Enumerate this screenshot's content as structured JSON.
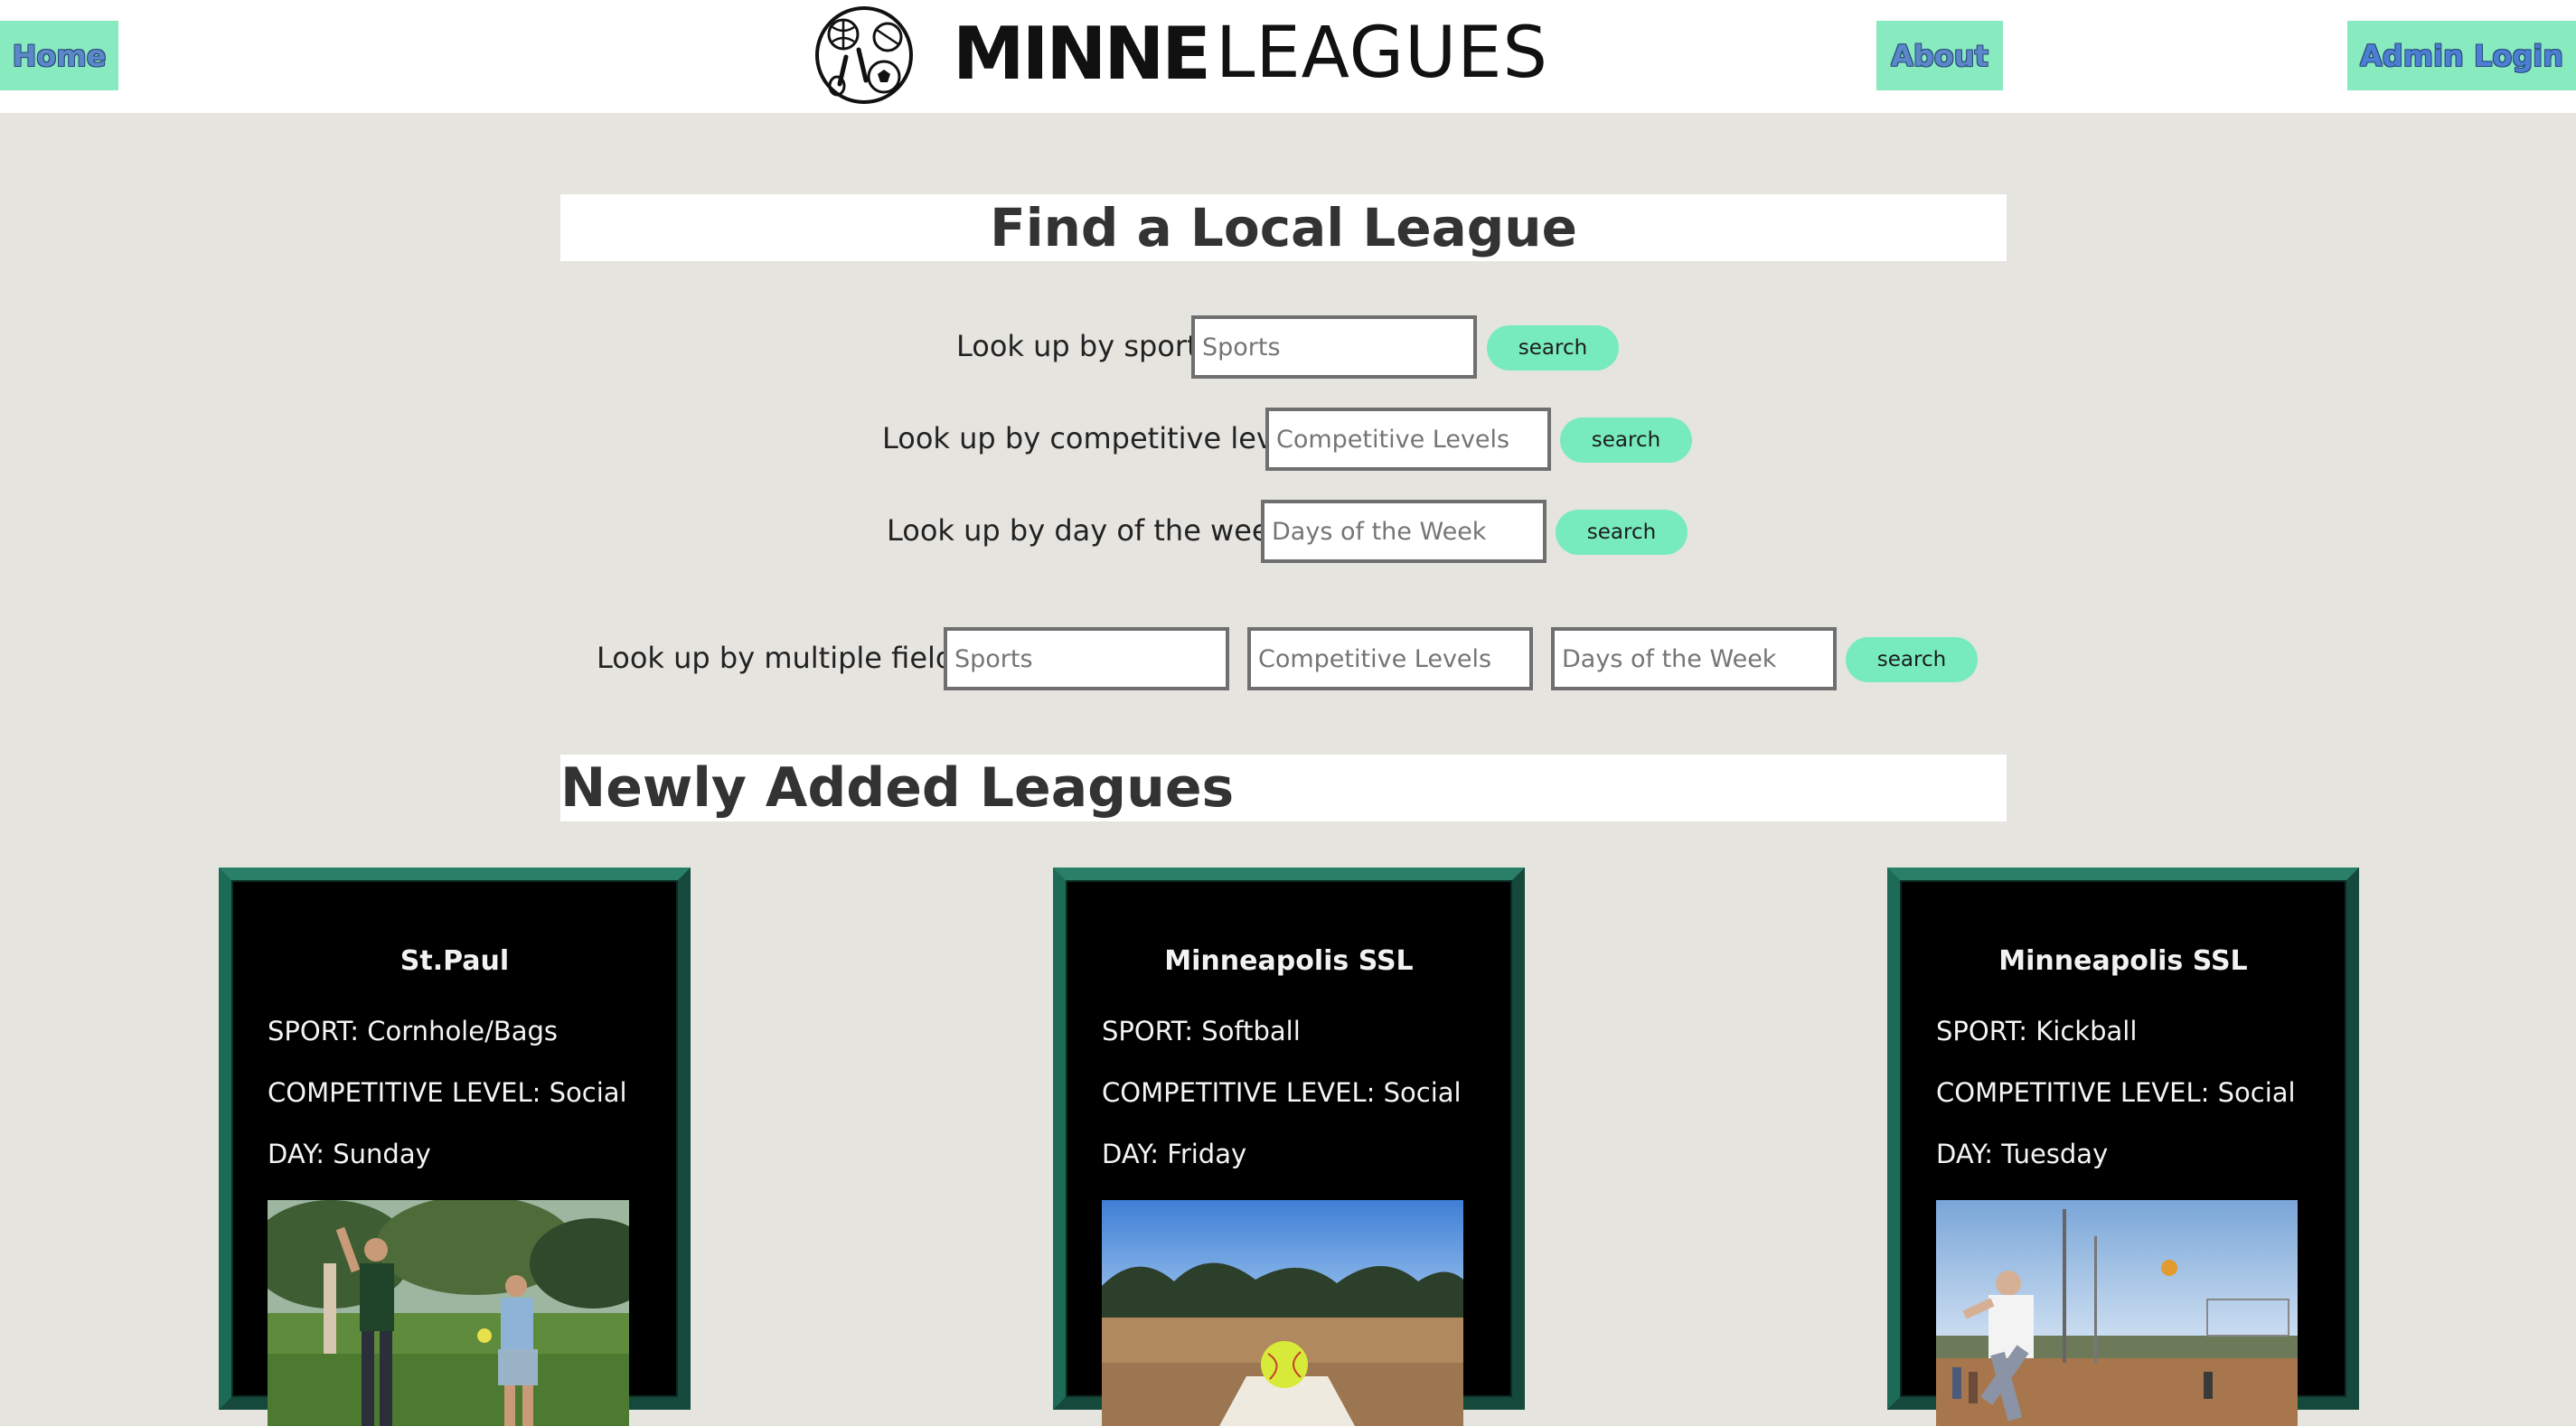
{
  "nav": {
    "home": "Home",
    "about": "About",
    "admin": "Admin Login"
  },
  "logo": {
    "bold": "MINNE",
    "light": "LEAGUES",
    "icon": "sports-balls-icon"
  },
  "find": {
    "title": "Find a Local League",
    "rows": [
      {
        "label": "Look up by sport:",
        "placeholder": "Sports",
        "button": "search"
      },
      {
        "label": "Look up by competitive level:",
        "placeholder": "Competitive Levels",
        "button": "search"
      },
      {
        "label": "Look up by day of the week:",
        "placeholder": "Days of the Week",
        "button": "search"
      }
    ],
    "multi": {
      "label": "Look up by multiple fields:",
      "placeholders": [
        "Sports",
        "Competitive Levels",
        "Days of the Week"
      ],
      "button": "search"
    }
  },
  "newly": {
    "title": "Newly Added Leagues",
    "cards": [
      {
        "name": "St.Paul",
        "sport": "SPORT: Cornhole/Bags",
        "level": "COMPETITIVE LEVEL: Social",
        "day": "DAY: Sunday",
        "photo": "cornhole-players-photo"
      },
      {
        "name": "Minneapolis SSL",
        "sport": "SPORT: Softball",
        "level": "COMPETITIVE LEVEL: Social",
        "day": "DAY: Friday",
        "photo": "softball-on-base-photo"
      },
      {
        "name": "Minneapolis SSL",
        "sport": "SPORT: Kickball",
        "level": "COMPETITIVE LEVEL: Social",
        "day": "DAY: Tuesday",
        "photo": "kickball-player-photo"
      }
    ]
  },
  "colors": {
    "accent": "#88ebc0",
    "background": "#e5e4df",
    "card_border": "#1d6b57"
  }
}
